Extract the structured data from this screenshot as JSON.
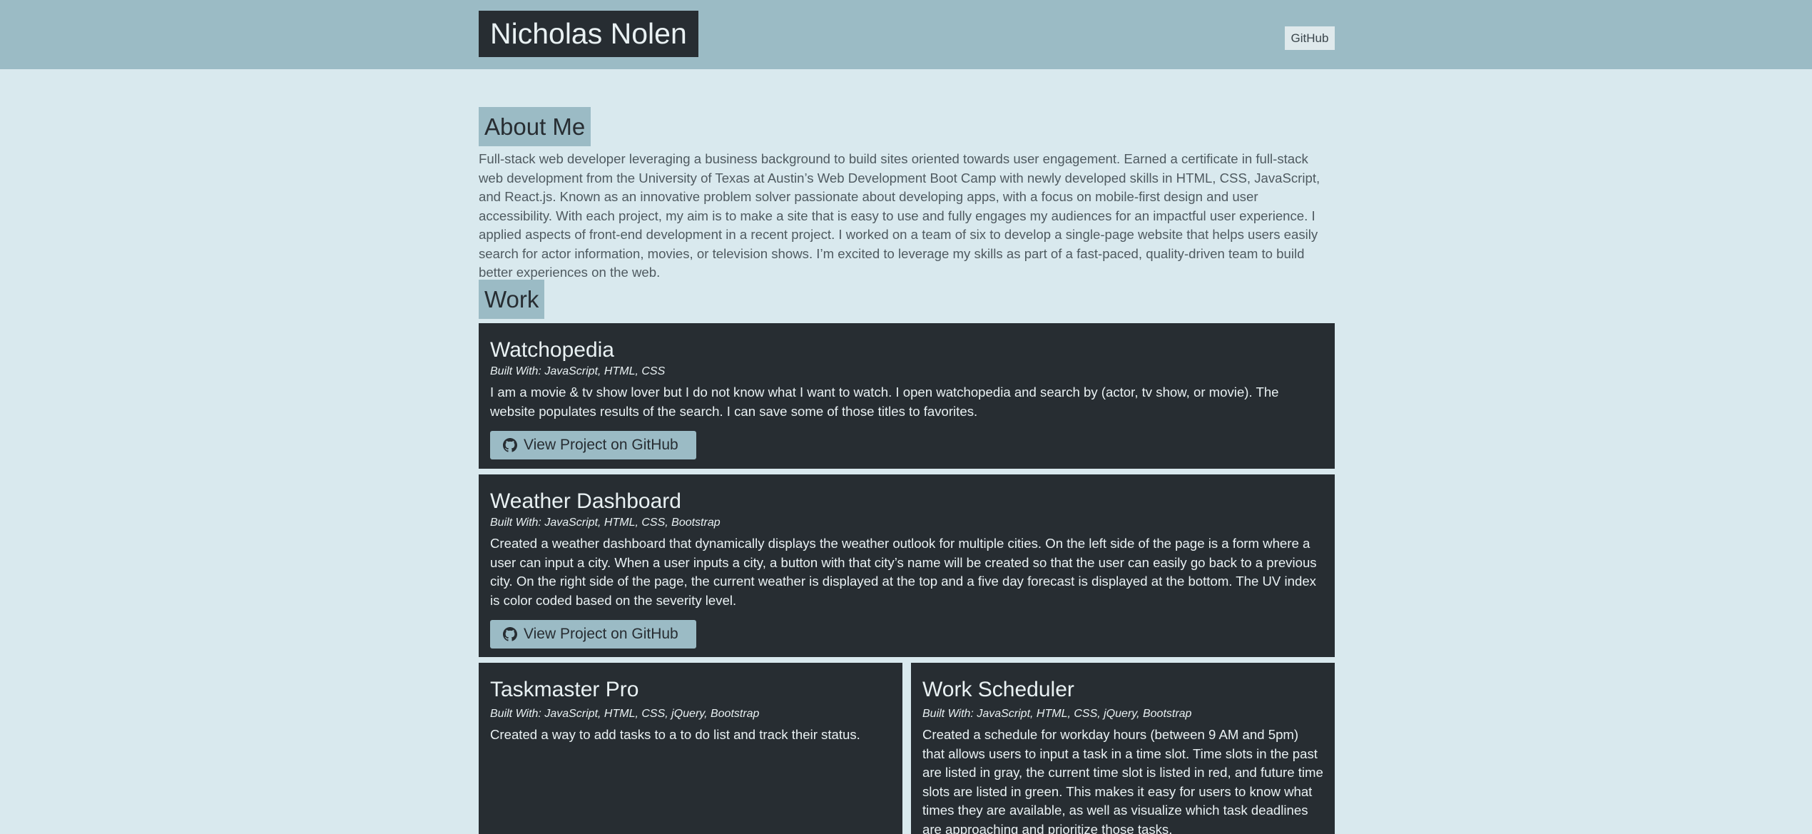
{
  "header": {
    "name": "Nicholas Nolen",
    "github_link": "GitHub"
  },
  "about": {
    "heading": "About Me",
    "text": "Full-stack web developer leveraging a business background to build sites oriented towards user engagement. Earned a certificate in full-stack web development from the University of Texas at Austin’s Web Development Boot Camp with newly developed skills in HTML, CSS, JavaScript, and React.js. Known as an innovative problem solver passionate about developing apps, with a focus on mobile-first design and user accessibility. With each project, my aim is to make a site that is easy to use and fully engages my audiences for an impactful user experience. I applied aspects of front-end development in a recent project. I worked on a team of six to develop a single-page website that helps users easily search for actor information, movies, or television shows. I’m excited to leverage my skills as part of a fast-paced, quality-driven team to build better experiences on the web."
  },
  "work": {
    "heading": "Work",
    "projects": [
      {
        "title": "Watchopedia",
        "built_with": "Built With: JavaScript, HTML, CSS",
        "description": "I am a movie & tv show lover but I do not know what I want to watch. I open watchopedia and search by (actor, tv show, or movie). The website populates results of the search. I can save some of those titles to favorites.",
        "button_label": "View Project on GitHub",
        "button_icon": "github-icon"
      },
      {
        "title": "Weather Dashboard",
        "built_with": "Built With: JavaScript, HTML, CSS, Bootstrap",
        "description": "Created a weather dashboard that dynamically displays the weather outlook for multiple cities. On the left side of the page is a form where a user can input a city. When a user inputs a city, a button with that city’s name will be created so that the user can easily go back to a previous city. On the right side of the page, the current weather is displayed at the top and a five day forecast is displayed at the bottom. The UV index is color coded based on the severity level.",
        "button_label": "View Project on GitHub",
        "button_icon": "github-icon"
      },
      {
        "title": "Taskmaster Pro",
        "built_with": "Built With: JavaScript, HTML, CSS, jQuery, Bootstrap",
        "description": "Created a way to add tasks to a to do list and track their status."
      },
      {
        "title": "Work Scheduler",
        "built_with": "Built With: JavaScript, HTML, CSS, jQuery, Bootstrap",
        "description": "Created a schedule for workday hours (between 9 AM and 5pm) that allows users to input a task in a time slot. Time slots in the past are listed in gray, the current time slot is listed in red, and future time slots are listed in green. This makes it easy for users to know what times they are available, as well as visualize which task deadlines are approaching and prioritize those tasks."
      }
    ]
  },
  "colors": {
    "page_background": "#d9e9ee",
    "header_background": "#9bbbc5",
    "card_background": "#272d32",
    "accent": "#9bbbc5",
    "card_text": "#e9f1f3"
  }
}
